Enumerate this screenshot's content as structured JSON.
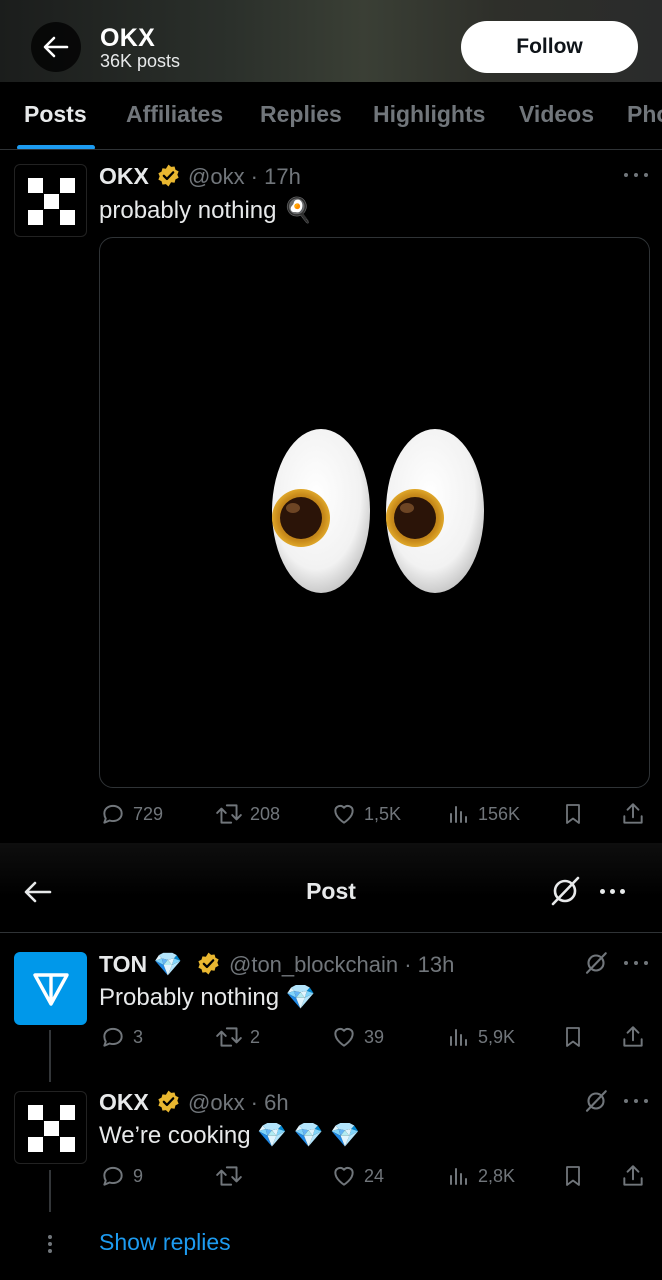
{
  "header": {
    "title": "OKX",
    "subtitle": "36K posts",
    "follow_label": "Follow"
  },
  "tabs": [
    {
      "label": "Posts",
      "active": true
    },
    {
      "label": "Affiliates"
    },
    {
      "label": "Replies"
    },
    {
      "label": "Highlights"
    },
    {
      "label": "Videos"
    },
    {
      "label": "Pho"
    }
  ],
  "post1": {
    "name": "OKX",
    "handle": "@okx · 17h",
    "text": "probably nothing 🍳",
    "stats": {
      "replies": "729",
      "reposts": "208",
      "likes": "1,5K",
      "views": "156K"
    }
  },
  "post_screen": {
    "title": "Post"
  },
  "post2": {
    "name": "TON 💎",
    "handle": "@ton_blockchain · 13h",
    "text": "Probably nothing 💎",
    "stats": {
      "replies": "3",
      "reposts": "2",
      "likes": "39",
      "views": "5,9K"
    }
  },
  "post3": {
    "name": "OKX",
    "handle": "@okx · 6h",
    "text": "We’re cooking 💎 💎 💎",
    "stats": {
      "replies": "9",
      "reposts": "",
      "likes": "24",
      "views": "2,8K"
    }
  },
  "show_replies": "Show replies",
  "colors": {
    "accent": "#1d9bf0",
    "verified": "#e9b730",
    "ton": "#0098ea"
  }
}
